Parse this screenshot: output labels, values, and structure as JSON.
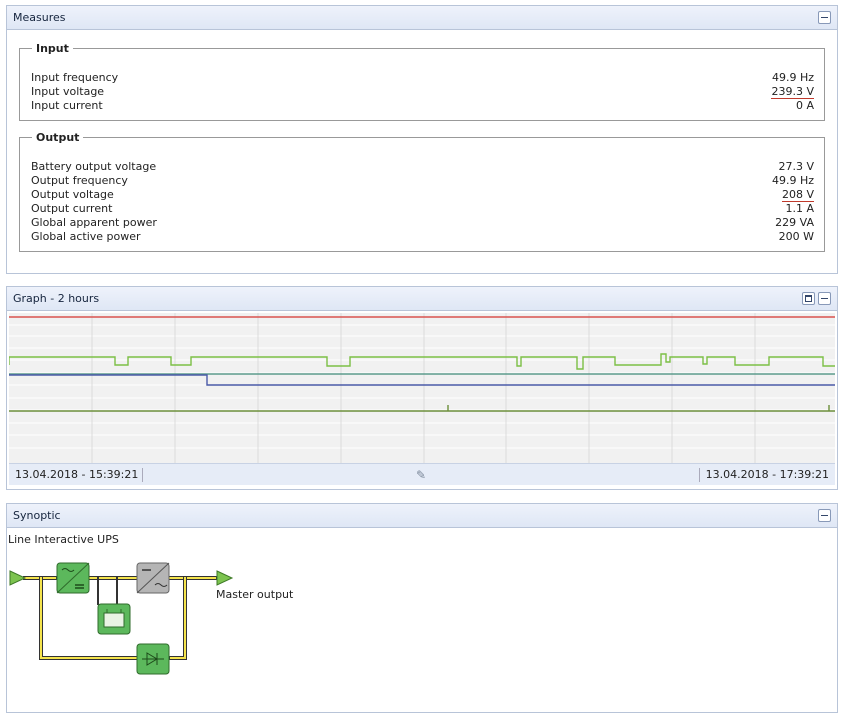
{
  "measures": {
    "title": "Measures",
    "input": {
      "legend": "Input",
      "rows": [
        {
          "label": "Input frequency",
          "value": "49.9 Hz",
          "alert": false
        },
        {
          "label": "Input voltage",
          "value": "239.3 V",
          "alert": true
        },
        {
          "label": "Input current",
          "value": "0 A",
          "alert": false
        }
      ]
    },
    "output": {
      "legend": "Output",
      "rows": [
        {
          "label": "Battery output voltage",
          "value": "27.3 V",
          "alert": false
        },
        {
          "label": "Output frequency",
          "value": "49.9 Hz",
          "alert": false
        },
        {
          "label": "Output voltage",
          "value": "208 V",
          "alert": true
        },
        {
          "label": "Output current",
          "value": "1.1 A",
          "alert": false
        },
        {
          "label": "Global apparent power",
          "value": "229 VA",
          "alert": false
        },
        {
          "label": "Global active power",
          "value": "200 W",
          "alert": false
        }
      ]
    }
  },
  "graph": {
    "title": "Graph - 2 hours",
    "start_time": "13.04.2018 - 15:39:21",
    "end_time": "13.04.2018 - 17:39:21",
    "colors": {
      "red": "#d9534f",
      "green": "#7cbf45",
      "teal": "#5b9a8b",
      "blue": "#4a5aa8",
      "olive": "#6b8e3a"
    }
  },
  "synoptic": {
    "title": "Synoptic",
    "ups_type": "Line Interactive UPS",
    "master_output_label": "Master output"
  }
}
